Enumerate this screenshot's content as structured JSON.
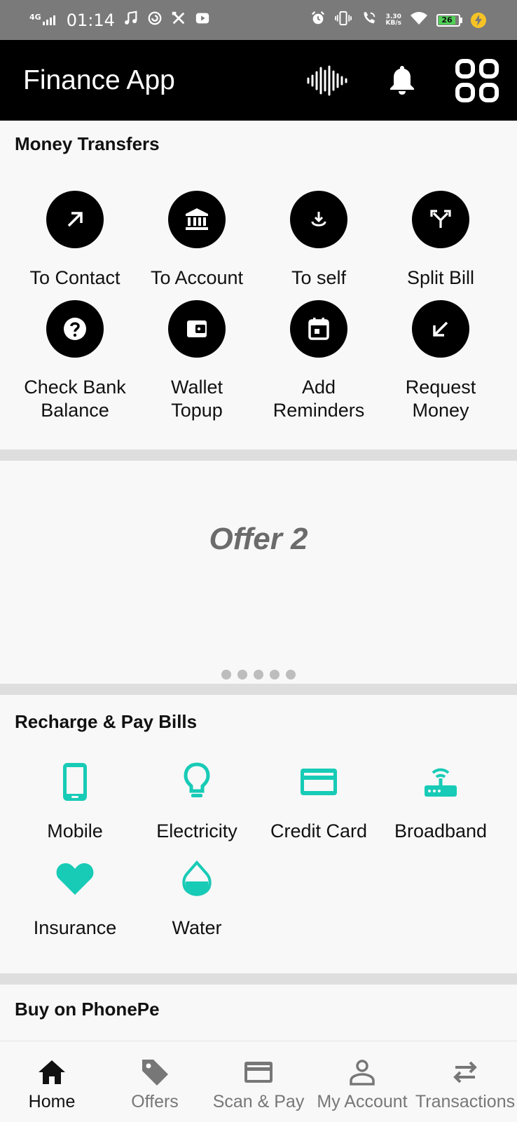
{
  "status_bar": {
    "network": "4G",
    "time": "01:14",
    "speed_value": "3.30",
    "speed_unit": "KB/s",
    "battery": "26",
    "icons": [
      "signal-icon",
      "music-icon",
      "sync-icon",
      "tools-icon",
      "youtube-icon",
      "alarm-icon",
      "vibrate-icon",
      "wifi-call-icon",
      "wifi-icon",
      "battery-icon",
      "charging-icon"
    ]
  },
  "app_bar": {
    "title": "Finance App",
    "icons": [
      "voice-wave-icon",
      "bell-icon",
      "grid-menu-icon"
    ]
  },
  "money_transfers": {
    "title": "Money Transfers",
    "items": [
      {
        "label": "To Contact",
        "icon": "arrow-up-right-icon"
      },
      {
        "label": "To Account",
        "icon": "bank-icon"
      },
      {
        "label": "To self",
        "icon": "download-icon"
      },
      {
        "label": "Split Bill",
        "icon": "split-arrows-icon"
      },
      {
        "label_line1": "Check Bank",
        "label_line2": "Balance",
        "icon": "question-circle-icon"
      },
      {
        "label_line1": "Wallet",
        "label_line2": "Topup",
        "icon": "wallet-icon"
      },
      {
        "label_line1": "Add",
        "label_line2": "Reminders",
        "icon": "calendar-icon"
      },
      {
        "label_line1": "Request",
        "label_line2": "Money",
        "icon": "arrow-down-left-icon"
      }
    ]
  },
  "offer_banner": {
    "text": "Offer 2",
    "page_count": 5
  },
  "recharge": {
    "title": "Recharge & Pay Bills",
    "accent": "#17cbb6",
    "items": [
      {
        "label": "Mobile",
        "icon": "mobile-icon"
      },
      {
        "label": "Electricity",
        "icon": "bulb-icon"
      },
      {
        "label": "Credit Card",
        "icon": "credit-card-icon"
      },
      {
        "label": "Broadband",
        "icon": "router-icon"
      },
      {
        "label": "Insurance",
        "icon": "heart-icon"
      },
      {
        "label": "Water",
        "icon": "water-drop-icon"
      }
    ]
  },
  "buy": {
    "title": "Buy on PhonePe"
  },
  "bottom_nav": {
    "items": [
      {
        "label": "Home",
        "icon": "home-icon",
        "active": true
      },
      {
        "label": "Offers",
        "icon": "tag-icon",
        "active": false
      },
      {
        "label": "Scan & Pay",
        "icon": "card-icon",
        "active": false
      },
      {
        "label": "My Account",
        "icon": "person-icon",
        "active": false
      },
      {
        "label": "Transactions",
        "icon": "swap-arrows-icon",
        "active": false
      }
    ]
  }
}
